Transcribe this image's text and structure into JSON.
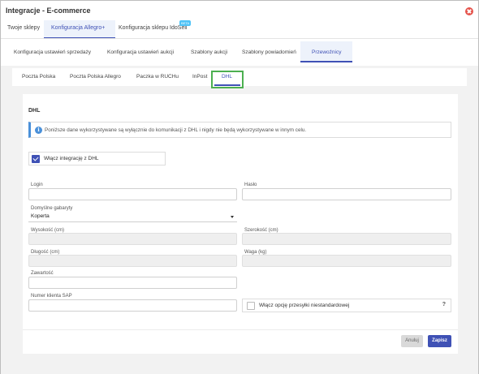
{
  "window": {
    "title": "Integracje - E-commerce"
  },
  "tabs_main": [
    {
      "label": "Twoje sklepy"
    },
    {
      "label": "Konfiguracja Allegro+"
    },
    {
      "label": "Konfiguracja sklepu IdoSell",
      "badge": "BETA"
    }
  ],
  "tabs_sub": [
    {
      "label": "Konfiguracja ustawień sprzedaży"
    },
    {
      "label": "Konfiguracja ustawień aukcji"
    },
    {
      "label": "Szablony aukcji"
    },
    {
      "label": "Szablony powiadomień"
    },
    {
      "label": "Przewoźnicy"
    }
  ],
  "tabs_carrier": [
    {
      "label": "Poczta Polska"
    },
    {
      "label": "Poczta Polska Allegro"
    },
    {
      "label": "Paczka w RUCHu"
    },
    {
      "label": "InPost"
    },
    {
      "label": "DHL"
    }
  ],
  "section_title": "DHL",
  "info": {
    "icon": "info-icon",
    "text": "Poniższe dane wykorzystywane są wyłącznie do komunikacji z DHL i nigdy nie będą wykorzystywane w innym celu."
  },
  "enable_integration": {
    "label": "Włącz integrację z DHL",
    "checked": true
  },
  "form": {
    "login_label": "Login",
    "password_label": "Hasło",
    "dimensions_label": "Domyślne gabaryty",
    "dimensions_value": "Koperta",
    "height_label": "Wysokość (cm)",
    "width_label": "Szerokość (cm)",
    "length_label": "Długość (cm)",
    "weight_label": "Waga (kg)",
    "content_label": "Zawartość",
    "sap_label": "Numer klienta SAP",
    "nonstandard_label": "Włącz opcję przesyłki niestandardowej",
    "help": "?"
  },
  "buttons": {
    "cancel": "Anuluj",
    "save": "Zapisz"
  },
  "colors": {
    "accent": "#3f51b5",
    "close": "#e5534b",
    "highlight": "#4caf50",
    "info": "#4a90d9"
  }
}
